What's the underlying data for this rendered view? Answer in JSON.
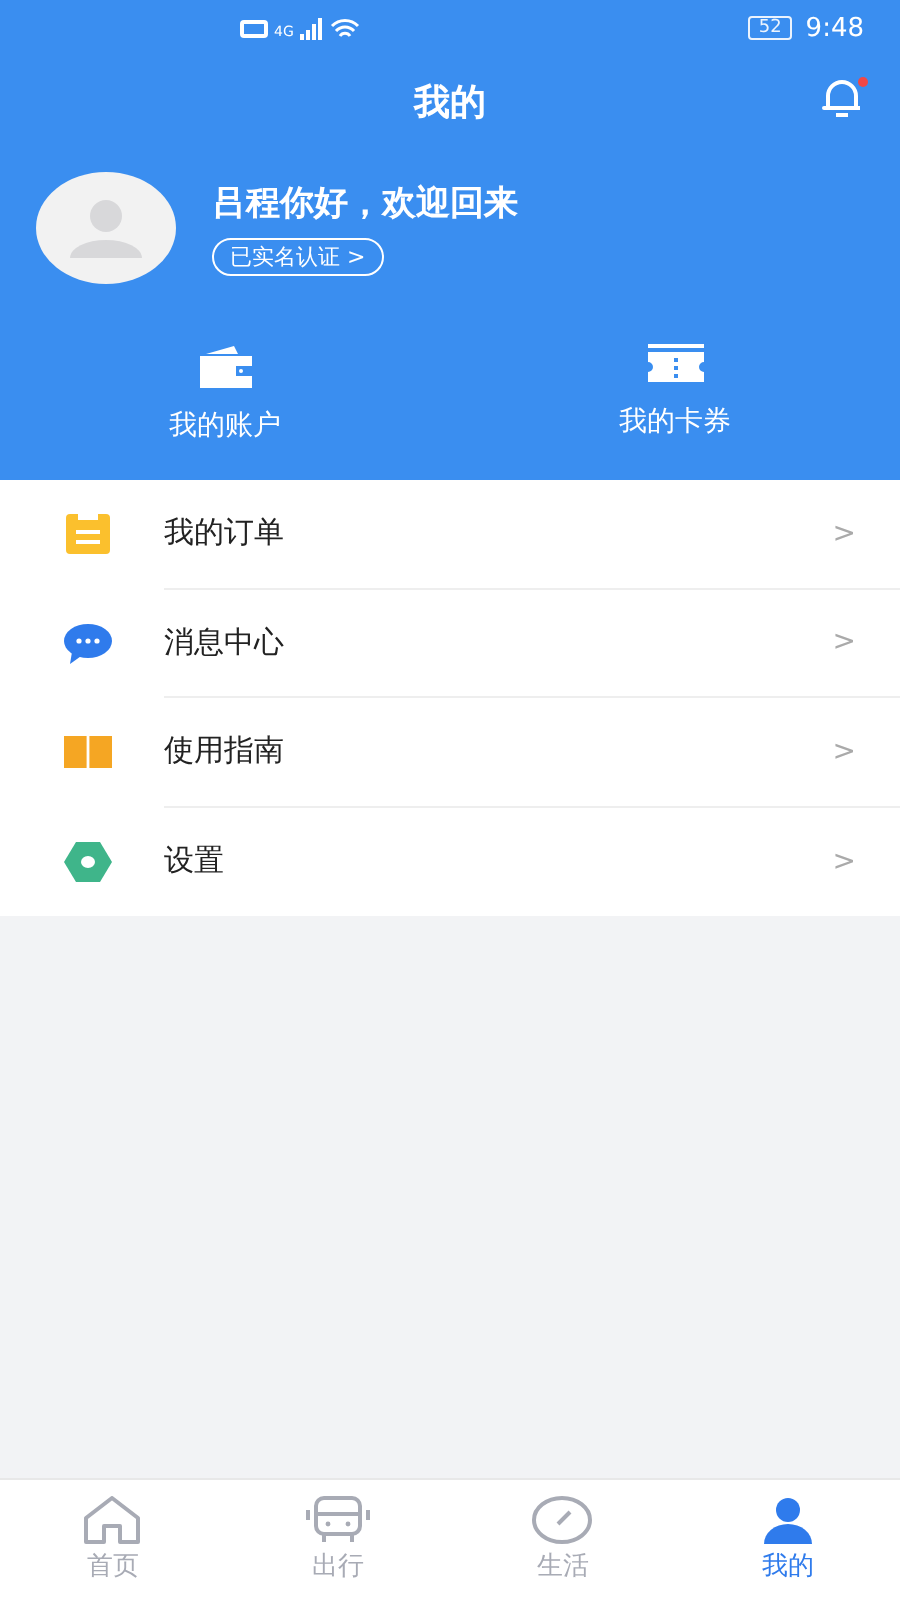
{
  "status_bar": {
    "network": "4G",
    "battery": "52",
    "time": "9:48"
  },
  "header": {
    "title": "我的",
    "notification_unread": true
  },
  "profile": {
    "greeting": "吕程你好，欢迎回来",
    "verify_label": "已实名认证 >"
  },
  "shortcuts": [
    {
      "kind": "wallet",
      "label": "我的账户"
    },
    {
      "kind": "ticket",
      "label": "我的卡券"
    }
  ],
  "menu": [
    {
      "kind": "order",
      "label": "我的订单",
      "chevron": ">"
    },
    {
      "kind": "message",
      "label": "消息中心",
      "chevron": ">"
    },
    {
      "kind": "guide",
      "label": "使用指南",
      "chevron": ">"
    },
    {
      "kind": "settings",
      "label": "设置",
      "chevron": ">"
    }
  ],
  "tabs": [
    {
      "kind": "home",
      "label": "首页",
      "selected": false
    },
    {
      "kind": "travel",
      "label": "出行",
      "selected": false
    },
    {
      "kind": "life",
      "label": "生活",
      "selected": false
    },
    {
      "kind": "me",
      "label": "我的",
      "selected": true
    }
  ]
}
